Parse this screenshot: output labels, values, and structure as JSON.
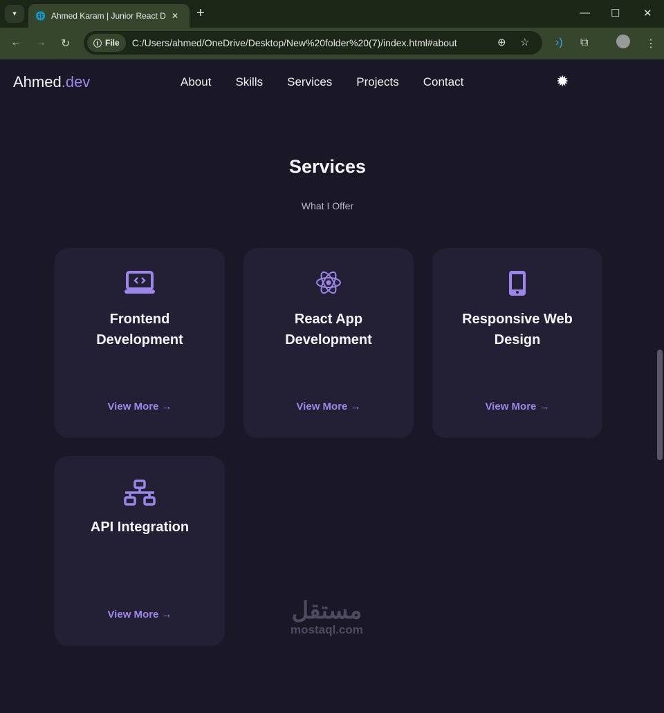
{
  "browser": {
    "tab_title": "Ahmed Karam | Junior React Developer",
    "url": "C:/Users/ahmed/OneDrive/Desktop/New%20folder%20(7)/index.html#about",
    "file_chip": "File"
  },
  "site": {
    "logo_main": "Ahmed",
    "logo_accent": ".dev",
    "nav": [
      "About",
      "Skills",
      "Services",
      "Projects",
      "Contact"
    ]
  },
  "section": {
    "title": "Services",
    "subtitle": "What I Offer"
  },
  "cards": [
    {
      "title": "Frontend Development",
      "icon": "laptop-code-icon",
      "link": "View More"
    },
    {
      "title": "React App Development",
      "icon": "react-icon",
      "link": "View More"
    },
    {
      "title": "Responsive Web Design",
      "icon": "mobile-icon",
      "link": "View More"
    },
    {
      "title": "API Integration",
      "icon": "network-icon",
      "link": "View More"
    }
  ],
  "watermark": {
    "arabic": "مستقل",
    "latin": "mostaql.com"
  },
  "colors": {
    "accent": "#9d86e9",
    "background": "#1a1727",
    "card": "#231f35"
  }
}
